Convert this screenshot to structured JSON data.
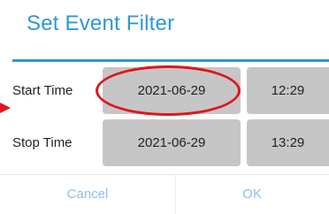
{
  "dialog": {
    "title": "Set Event Filter",
    "accent_color": "#2f97d6"
  },
  "rows": {
    "start": {
      "label": "Start Time",
      "date": "2021-06-29",
      "time": "12:29"
    },
    "stop": {
      "label": "Stop Time",
      "date": "2021-06-29",
      "time": "13:29"
    }
  },
  "buttons": {
    "cancel": "Cancel",
    "ok": "OK"
  },
  "annotation": {
    "highlight_color": "#e0161b",
    "highlights": "start-date",
    "arrow_icon": "red-arrow-icon"
  }
}
